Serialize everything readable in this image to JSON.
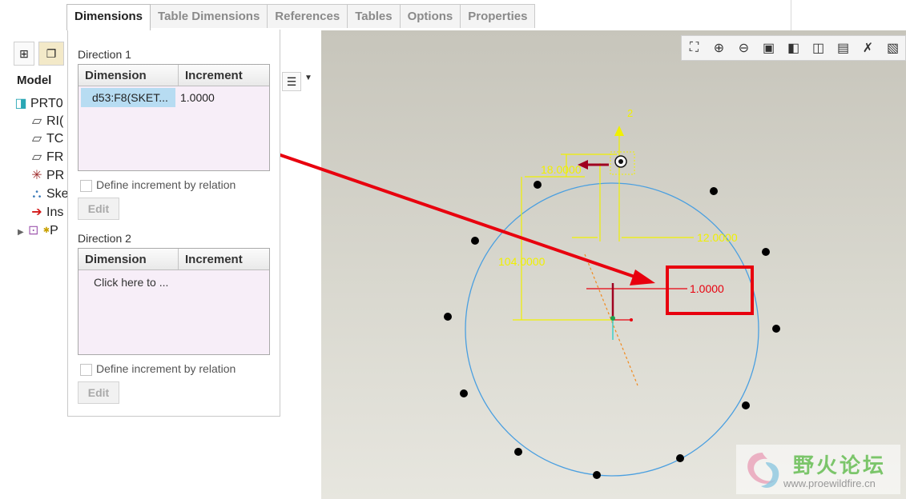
{
  "tabs": [
    "Dimensions",
    "Table Dimensions",
    "References",
    "Tables",
    "Options",
    "Properties"
  ],
  "model_tree": {
    "tab_label": "Model",
    "items": [
      {
        "icon": "part-icon",
        "label": "PRT0"
      },
      {
        "icon": "datum-plane-icon",
        "label": "RI("
      },
      {
        "icon": "datum-plane-icon",
        "label": "TC"
      },
      {
        "icon": "datum-plane-icon",
        "label": "FR"
      },
      {
        "icon": "csys-icon",
        "label": "PR"
      },
      {
        "icon": "sketch-icon",
        "label": "Ske"
      },
      {
        "icon": "insert-here-icon",
        "label": "Ins"
      },
      {
        "icon": "pattern-icon",
        "label": "P"
      }
    ]
  },
  "panel": {
    "direction1": {
      "title": "Direction 1",
      "col_dimension": "Dimension",
      "col_increment": "Increment",
      "rows": [
        {
          "dimension": "d53:F8(SKET...",
          "increment": "1.0000"
        }
      ],
      "checkbox_label": "Define increment by relation",
      "edit_label": "Edit"
    },
    "direction2": {
      "title": "Direction 2",
      "col_dimension": "Dimension",
      "col_increment": "Increment",
      "placeholder": "Click here to ...",
      "checkbox_label": "Define increment by relation",
      "edit_label": "Edit"
    }
  },
  "viewport": {
    "dimensions": {
      "d1": "18.0000",
      "d2": "12.0000",
      "d3": "104.0000",
      "increment": "1.0000"
    },
    "axis_label": "2",
    "colors": {
      "circle": "#4a9fe0",
      "dim": "#f0f000",
      "highlight": "#e8000e",
      "arrow_red": "#a00020"
    }
  },
  "watermark": {
    "title": "野火论坛",
    "url": "www.proewildfire.cn"
  }
}
